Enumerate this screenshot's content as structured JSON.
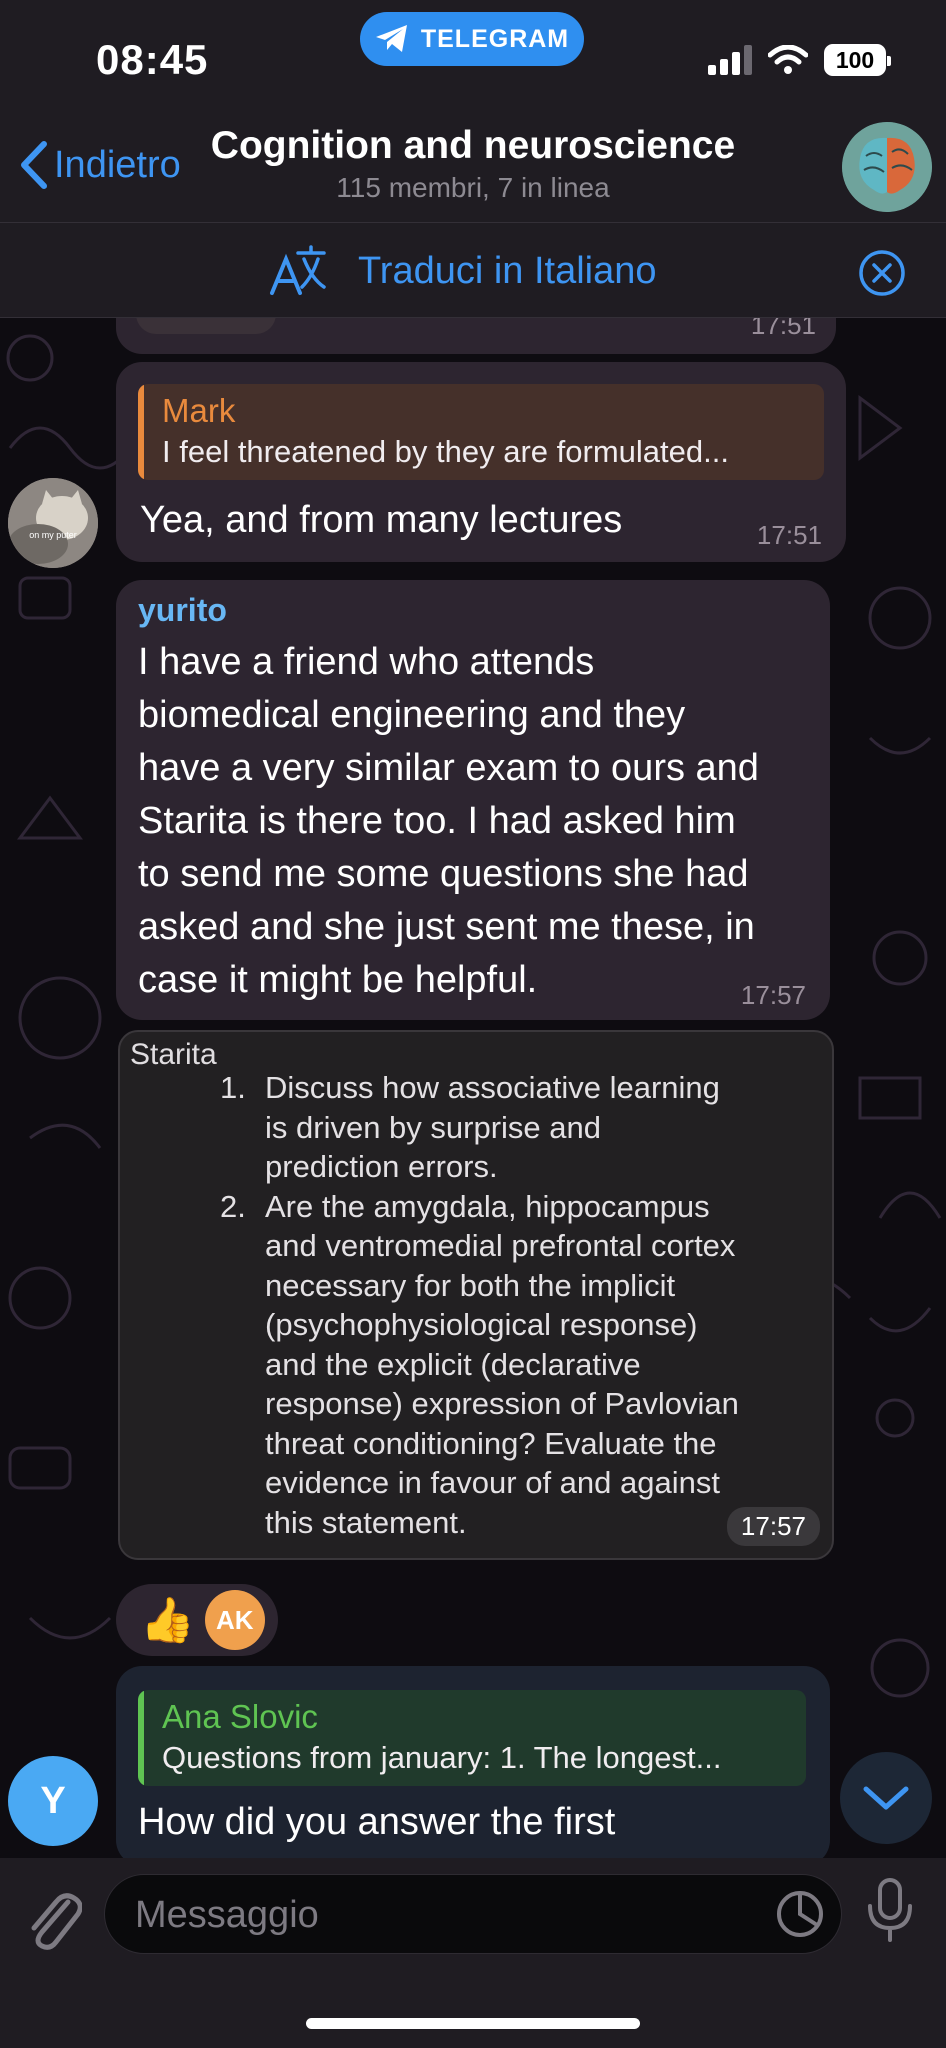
{
  "status_bar": {
    "time": "08:45",
    "app_pill": "TELEGRAM",
    "battery": "100"
  },
  "header": {
    "back_label": "Indietro",
    "title": "Cognition and neuroscience",
    "subtitle": "115 membri, 7 in linea"
  },
  "translate": {
    "label": "Traduci in Italiano"
  },
  "messages": {
    "prev_time": "17:51",
    "mark_reply": {
      "reply_name": "Mark",
      "reply_text": "I feel threatened by they are formulated...",
      "text": "Yea, and from many lectures",
      "time": "17:51",
      "avatar_caption": "on my puter"
    },
    "yurito": {
      "sender": "yurito",
      "lines": [
        "I have a friend who attends",
        "biomedical engineering and they",
        "have a very similar exam to ours and",
        "Starita is there too. I had asked him",
        "to send me some questions she had",
        "asked and she just sent me these, in",
        "case it might be helpful."
      ],
      "time": "17:57"
    },
    "image_message": {
      "title": "Starita",
      "items": [
        {
          "num": "1.",
          "lines": [
            "Discuss how associative learning",
            "is driven by surprise and",
            "prediction errors."
          ]
        },
        {
          "num": "2.",
          "lines": [
            "Are the amygdala, hippocampus",
            "and ventromedial prefrontal cortex",
            "necessary for both the implicit",
            "(psychophysiological response)",
            "and the explicit (declarative",
            "response) expression of Pavlovian",
            "threat conditioning? Evaluate the",
            "evidence in favour of and against",
            "this statement."
          ]
        }
      ],
      "time": "17:57"
    },
    "reactions": {
      "emoji": "👍",
      "reactor_initials": "AK"
    },
    "last": {
      "reply_name": "Ana Slovic",
      "reply_text": "Questions from january: 1. The longest...",
      "text": "How did you answer the first",
      "avatar_initial": "Y"
    }
  },
  "input": {
    "placeholder": "Messaggio"
  },
  "colors": {
    "accent": "#3e95f2",
    "bubble": "#2d2530",
    "mark_name": "#e98a3d",
    "yurito_name": "#68b7f4",
    "ana_name": "#5fc452"
  }
}
